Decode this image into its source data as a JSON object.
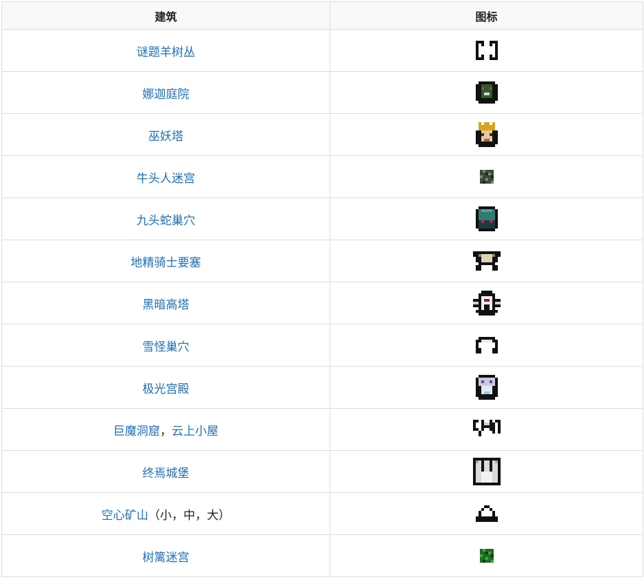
{
  "table": {
    "headers": [
      "建筑",
      "图标"
    ],
    "rows": [
      {
        "parts": [
          {
            "text": "谜题羊树丛",
            "link": true
          }
        ],
        "icon": "hedge-maze-icon"
      },
      {
        "parts": [
          {
            "text": "娜迦庭院",
            "link": true
          }
        ],
        "icon": "naga-courtyard-icon"
      },
      {
        "parts": [
          {
            "text": "巫妖塔",
            "link": true
          }
        ],
        "icon": "lich-tower-icon"
      },
      {
        "parts": [
          {
            "text": "牛头人迷宫",
            "link": true
          }
        ],
        "icon": "minotaur-labyrinth-icon"
      },
      {
        "parts": [
          {
            "text": "九头蛇巢穴",
            "link": true
          }
        ],
        "icon": "hydra-lair-icon"
      },
      {
        "parts": [
          {
            "text": "地精骑士要塞",
            "link": true
          }
        ],
        "icon": "goblin-knight-stronghold-icon"
      },
      {
        "parts": [
          {
            "text": "黑暗高塔",
            "link": true
          }
        ],
        "icon": "dark-tower-icon"
      },
      {
        "parts": [
          {
            "text": "雪怪巢穴",
            "link": true
          }
        ],
        "icon": "yeti-lair-icon"
      },
      {
        "parts": [
          {
            "text": "极光宫殿",
            "link": true
          }
        ],
        "icon": "aurora-palace-icon"
      },
      {
        "parts": [
          {
            "text": "巨魔洞窟",
            "link": true
          },
          {
            "text": "，",
            "link": false
          },
          {
            "text": "云上小屋",
            "link": true
          }
        ],
        "icon": "troll-cave-icon"
      },
      {
        "parts": [
          {
            "text": "终焉城堡",
            "link": true
          }
        ],
        "icon": "final-castle-icon"
      },
      {
        "parts": [
          {
            "text": "空心矿山",
            "link": true
          },
          {
            "text": "（小，中，大）",
            "link": false
          }
        ],
        "icon": "hollow-hill-icon"
      },
      {
        "parts": [
          {
            "text": "树篱迷宫",
            "link": true
          }
        ],
        "icon": "hedge-maze-small-icon"
      }
    ]
  },
  "colors": {
    "link": "#1e6fb8",
    "header_bg": "#f8f9fa",
    "border": "#dcdcdc"
  }
}
